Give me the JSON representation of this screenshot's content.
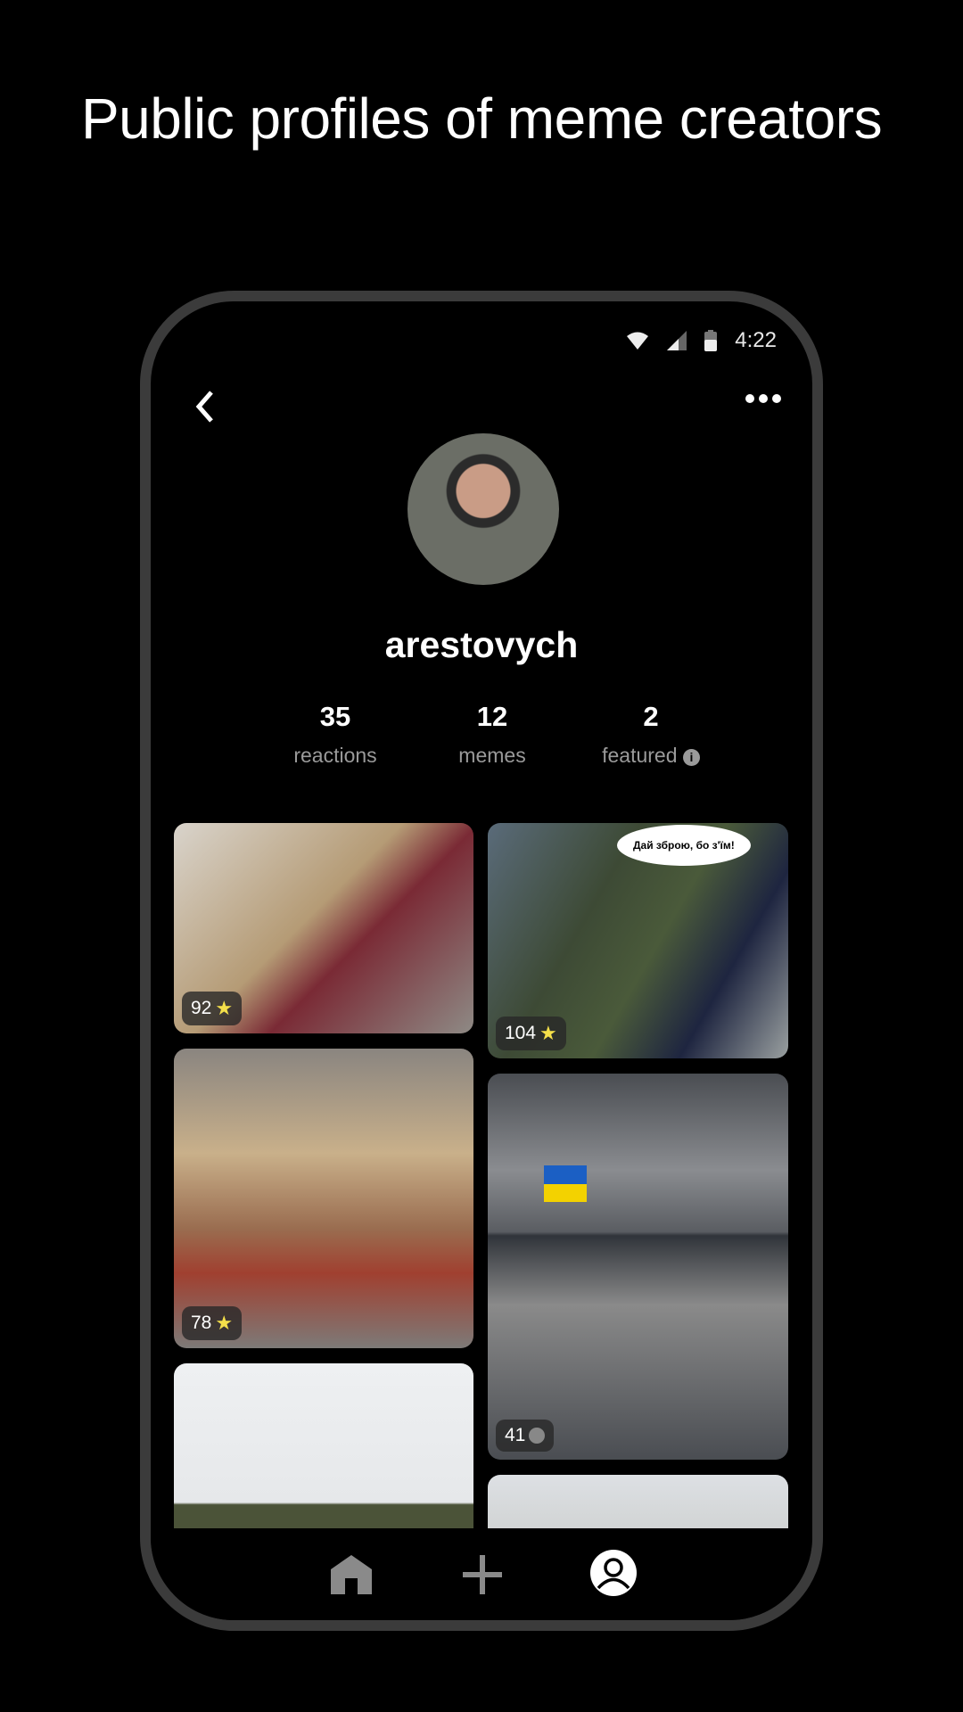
{
  "headline": "Public profiles of meme creators",
  "status_bar": {
    "time": "4:22",
    "icons": [
      "wifi-icon",
      "signal-icon",
      "battery-icon"
    ]
  },
  "profile": {
    "username": "arestovych"
  },
  "stats": [
    {
      "value": "35",
      "label": "reactions"
    },
    {
      "value": "12",
      "label": "memes"
    },
    {
      "value": "2",
      "label": "featured"
    }
  ],
  "memes": [
    {
      "count": "92",
      "reaction": "star"
    },
    {
      "count": "104",
      "reaction": "star",
      "caption": "Дай зброю, бо з'їм!"
    },
    {
      "count": "78",
      "reaction": "star"
    },
    {
      "count": "41",
      "reaction": "neutral"
    },
    {},
    {}
  ],
  "colors": {
    "star": "#f5e04a",
    "frame": "#3b3b3b",
    "muted": "#9a9a9a"
  },
  "nav": [
    "home-icon",
    "add-icon",
    "profile-icon"
  ]
}
